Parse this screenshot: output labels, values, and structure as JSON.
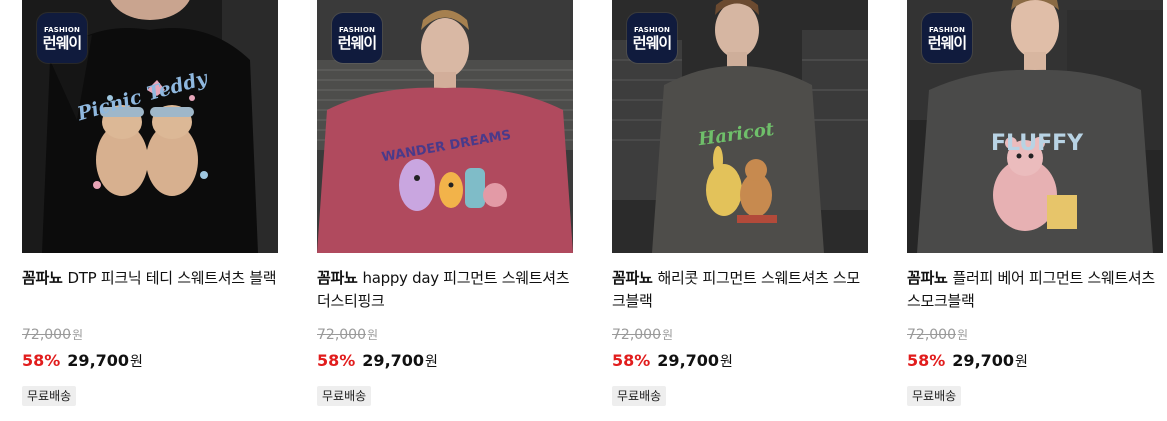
{
  "badge": {
    "small_text": "FASHION",
    "big_text": "런웨이"
  },
  "products": [
    {
      "brand": "꼼파뇨",
      "name": "DTP 피크닉 테디 스웨트셔츠 블랙",
      "graphic_text": "Picnic Teddy",
      "original_price": "72,000",
      "currency": "원",
      "discount_rate": "58%",
      "sale_price": "29,700",
      "shipping": "무료배송"
    },
    {
      "brand": "꼼파뇨",
      "name": "happy day 피그먼트 스웨트셔츠 더스티핑크",
      "graphic_text": "WANDER DREAMS",
      "original_price": "72,000",
      "currency": "원",
      "discount_rate": "58%",
      "sale_price": "29,700",
      "shipping": "무료배송"
    },
    {
      "brand": "꼼파뇨",
      "name": "해리콧 피그먼트 스웨트셔츠 스모크블랙",
      "graphic_text": "Haricot",
      "original_price": "72,000",
      "currency": "원",
      "discount_rate": "58%",
      "sale_price": "29,700",
      "shipping": "무료배송"
    },
    {
      "brand": "꼼파뇨",
      "name": "플러피 베어 피그먼트 스웨트셔츠 스모크블랙",
      "graphic_text": "FLUFFY",
      "original_price": "72,000",
      "currency": "원",
      "discount_rate": "58%",
      "sale_price": "29,700",
      "shipping": "무료배송"
    }
  ],
  "colors": {
    "discount": "#e11d1d",
    "badge_bg": "#101b3d",
    "shipping_bg": "#eeeeee"
  }
}
